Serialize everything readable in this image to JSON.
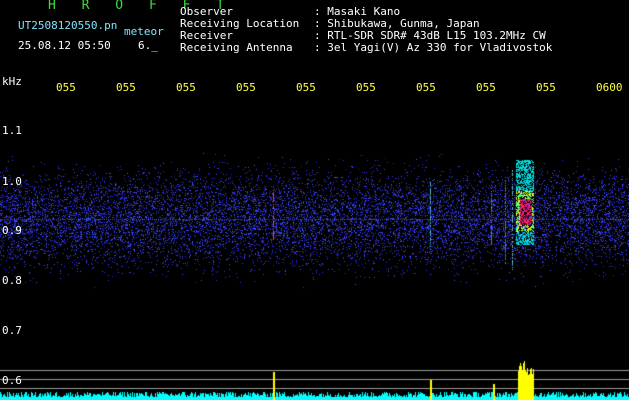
{
  "header": {
    "title": "H R O F F T",
    "filename": "UT2508120550.pn",
    "mode": "meteor",
    "datetime": "25.08.12 05:50",
    "extra": "6._",
    "info_labels": [
      "Observer",
      "Receiving Location",
      "Receiver",
      "Receiving Antenna"
    ],
    "info_values": [
      ": Masaki Kano",
      ": Shibukawa, Gunma, Japan",
      ": RTL-SDR SDR# 43dB L15 103.2MHz CW",
      ": 3el Yagi(V) Az 330 for Vladivostok"
    ]
  },
  "axis": {
    "unit": "kHz",
    "y_ticks": [
      "1.1",
      "1.0",
      "0.9",
      "0.8",
      "0.7",
      "0.6"
    ],
    "x_ticks": [
      "055",
      "055",
      "055",
      "055",
      "055",
      "055",
      "055",
      "055",
      "055",
      "0600"
    ]
  },
  "colors": {
    "background": "#000000",
    "noise": "#2a2aff",
    "trace": "#00ffff",
    "echo": "#ffff00",
    "hot": "#ff1a6a"
  }
}
